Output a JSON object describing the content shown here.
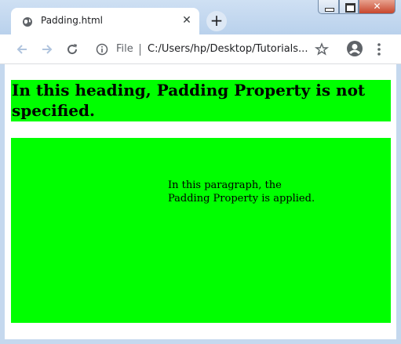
{
  "browser": {
    "tab_title": "Padding.html",
    "tab_close": "✕",
    "new_tab": "+",
    "file_label": "File",
    "url": "C:/Users/hp/Desktop/Tutorials...",
    "window_close": "✕"
  },
  "page": {
    "heading": "In this heading, Padding Property is not specified.",
    "paragraph": "In this paragraph, the Padding Property is applied."
  },
  "colors": {
    "content_background": "#00ff00",
    "titlebar": "#b9d1ec"
  },
  "icons": [
    "globe-icon",
    "back-arrow-icon",
    "forward-arrow-icon",
    "reload-icon",
    "info-icon",
    "star-icon",
    "profile-icon",
    "more-vert-icon"
  ]
}
